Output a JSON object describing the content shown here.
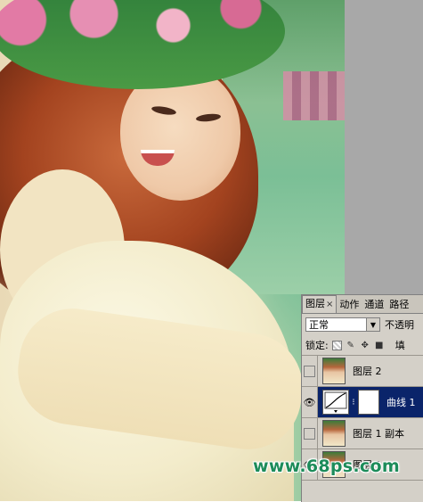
{
  "layers_panel": {
    "tabs": [
      {
        "label": "图层",
        "close": "×"
      },
      {
        "label": "动作"
      },
      {
        "label": "通道"
      },
      {
        "label": "路径"
      }
    ],
    "blend_mode": "正常",
    "opacity_label": "不透明",
    "lock_label": "锁定:",
    "fill_label": "填",
    "layers": [
      {
        "name": "图层 2",
        "visible": false,
        "selected": false
      },
      {
        "name": "曲线 1",
        "visible": true,
        "selected": true
      },
      {
        "name": "图层 1 副本",
        "visible": false,
        "selected": false
      },
      {
        "name": "图层 1",
        "visible": true,
        "selected": false
      }
    ]
  },
  "watermark": "www.68ps.com",
  "icons": {
    "eye": "eye-icon",
    "chain": "link-icon",
    "lock": "lock-icon",
    "move": "move-icon",
    "brush": "brush-icon"
  },
  "colors": {
    "selection": "#0a246a",
    "panel_bg": "#d4d0c8",
    "watermark": "#1d8c5a"
  }
}
